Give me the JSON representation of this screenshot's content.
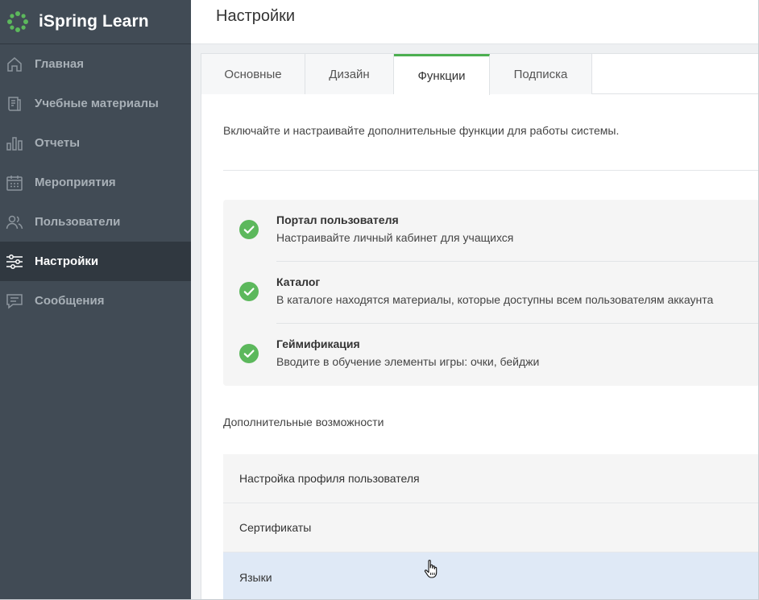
{
  "app": {
    "name": "iSpring Learn",
    "brand_color": "#5cb85c"
  },
  "sidebar": {
    "items": [
      {
        "label": "Главная",
        "icon": "home-icon"
      },
      {
        "label": "Учебные материалы",
        "icon": "materials-icon"
      },
      {
        "label": "Отчеты",
        "icon": "bar-chart-icon"
      },
      {
        "label": "Мероприятия",
        "icon": "calendar-icon"
      },
      {
        "label": "Пользователи",
        "icon": "users-icon"
      },
      {
        "label": "Настройки",
        "icon": "sliders-icon",
        "active": true
      },
      {
        "label": "Сообщения",
        "icon": "message-icon"
      }
    ]
  },
  "header": {
    "title": "Настройки"
  },
  "tabs": [
    {
      "label": "Основные"
    },
    {
      "label": "Дизайн"
    },
    {
      "label": "Функции",
      "active": true
    },
    {
      "label": "Подписка"
    }
  ],
  "intro": "Включайте и настраивайте дополнительные функции для работы системы.",
  "features": [
    {
      "title": "Портал пользователя",
      "description": "Настраивайте личный кабинет для учащихся",
      "enabled": true
    },
    {
      "title": "Каталог",
      "description": "В каталоге находятся материалы, которые доступны всем пользователям аккаунта",
      "enabled": true
    },
    {
      "title": "Геймификация",
      "description": "Вводите в обучение элементы игры: очки, бейджи",
      "enabled": true
    }
  ],
  "extra": {
    "title": "Дополнительные возможности",
    "items": [
      {
        "label": "Настройка профиля пользователя"
      },
      {
        "label": "Сертификаты"
      },
      {
        "label": "Языки",
        "hovered": true
      }
    ]
  },
  "colors": {
    "sidebar_bg": "#414b55",
    "sidebar_active_bg": "#303840",
    "accent_green": "#4caf50",
    "check_green": "#5cb85c",
    "hover_row": "#dfe9f6"
  }
}
